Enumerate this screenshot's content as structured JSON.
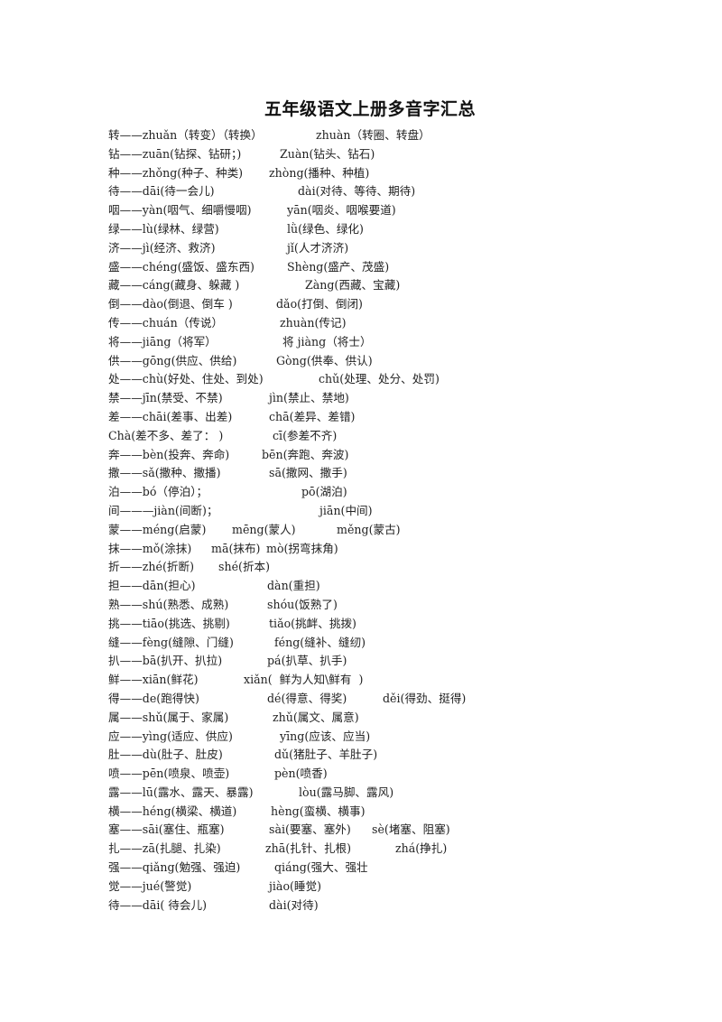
{
  "document": {
    "title": "五年级语文上册多音字汇总",
    "lines": [
      {
        "main": "转——zhuǎn（转变）（转换）",
        "alts": [
          "zhuàn（转圈、转盘）"
        ]
      },
      {
        "main": "钻——zuān(钻探、钻研；)",
        "alts": [
          "Zuàn(钻头、钻石)"
        ]
      },
      {
        "main": "种——zhǒng(种子、种类)",
        "alts": [
          "zhòng(播种、种植)"
        ]
      },
      {
        "main": "待——dāi(待一会儿)",
        "alts": [
          "dài(对待、等待、期待)"
        ]
      },
      {
        "main": "咽——yàn(咽气、细嚼慢咽)",
        "alts": [
          "yān(咽炎、咽喉要道)"
        ]
      },
      {
        "main": "绿——lù(绿林、绿营)",
        "alts": [
          "lǜ(绿色、绿化)"
        ]
      },
      {
        "main": "济——jì(经济、救济)",
        "alts": [
          "jǐ(人才济济)"
        ]
      },
      {
        "main": "盛——chéng(盛饭、盛东西)",
        "alts": [
          "Shèng(盛产、茂盛)"
        ]
      },
      {
        "main": "藏——cáng(藏身、躲藏 )",
        "alts": [
          "Zàng(西藏、宝藏)"
        ]
      },
      {
        "main": "倒——dào(倒退、倒车 )",
        "alts": [
          "dǎo(打倒、倒闭)"
        ]
      },
      {
        "main": "传——chuán（传说）",
        "alts": [
          "zhuàn(传记)"
        ]
      },
      {
        "main": "将——jiāng（将军）",
        "alts": [
          "将 jiàng（将士）"
        ]
      },
      {
        "main": "供——gōng(供应、供给)",
        "alts": [
          "Gòng(供奉、供认)"
        ]
      },
      {
        "main": "处——chù(好处、住处、到处)",
        "alts": [
          "chǔ(处理、处分、处罚)"
        ]
      },
      {
        "main": "禁——jīn(禁受、不禁)",
        "alts": [
          "jìn(禁止、禁地)"
        ]
      },
      {
        "main": "差——chāi(差事、出差)",
        "alts": [
          "chā(差异、差错)"
        ]
      },
      {
        "main": "Chà(差不多、差了： )",
        "alts": [
          "cī(参差不齐)"
        ]
      },
      {
        "main": "奔——bèn(投奔、奔命)",
        "alts": [
          "bēn(奔跑、奔波)"
        ]
      },
      {
        "main": "撒——sǎ(撒种、撒播)",
        "alts": [
          "sā(撒网、撒手)"
        ]
      },
      {
        "main": "泊——bó（停泊）；",
        "alts": [
          "pō(湖泊)"
        ]
      },
      {
        "main": "间———jiàn(间断)；",
        "alts": [
          "jiān(中间)"
        ]
      },
      {
        "main": "蒙——méng(启蒙)",
        "alts": [
          "mēng(蒙人)",
          "měng(蒙古)"
        ]
      },
      {
        "main": "抹——mǒ(涂抹)",
        "alts": [
          "mā(抹布)",
          "mò(拐弯抹角)"
        ]
      },
      {
        "main": "折——zhé(折断)",
        "alts": [
          "shé(折本)"
        ]
      },
      {
        "main": "担——dān(担心)",
        "alts": [
          "dàn(重担)"
        ]
      },
      {
        "main": "熟——shú(熟悉、成熟)",
        "alts": [
          "shóu(饭熟了)"
        ]
      },
      {
        "main": "挑——tiāo(挑选、挑剔)",
        "alts": [
          "tiǎo(挑衅、挑拨)"
        ]
      },
      {
        "main": "缝——fèng(缝隙、门缝)",
        "alts": [
          "féng(缝补、缝纫)"
        ]
      },
      {
        "main": "扒——bā(扒开、扒拉)",
        "alts": [
          "pá(扒草、扒手)"
        ]
      },
      {
        "main": "鲜——xiān(鲜花)",
        "alts": [
          "xiǎn(  鲜为人知\\鲜有  )"
        ]
      },
      {
        "main": "得——de(跑得快)",
        "alts": [
          "dé(得意、得奖)",
          "děi(得劲、挺得)"
        ]
      },
      {
        "main": "属——shǔ(属于、家属)",
        "alts": [
          "zhǔ(属文、属意)"
        ]
      },
      {
        "main": "应——yìng(适应、供应)",
        "alts": [
          "yīng(应该、应当)"
        ]
      },
      {
        "main": "肚——dù(肚子、肚皮)",
        "alts": [
          "dǔ(猪肚子、羊肚子)"
        ]
      },
      {
        "main": "喷——pēn(喷泉、喷壶)",
        "alts": [
          "pèn(喷香)"
        ]
      },
      {
        "main": "露——lū(露水、露天、暴露)",
        "alts": [
          "lòu(露马脚、露风)"
        ]
      },
      {
        "main": "横——héng(横梁、横道)",
        "alts": [
          "hèng(蛮横、横事)"
        ]
      },
      {
        "main": "塞——sāi(塞住、瓶塞)",
        "alts": [
          "sài(要塞、塞外)",
          "sè(堵塞、阻塞)"
        ]
      },
      {
        "main": "扎——zā(扎腿、扎染)",
        "alts": [
          "zhā(扎针、扎根)",
          "zhá(挣扎)"
        ]
      },
      {
        "main": "强——qiǎng(勉强、强迫)",
        "alts": [
          "qiáng(强大、强壮"
        ]
      },
      {
        "main": "觉——jué(警觉)",
        "alts": [
          "jiào(睡觉)"
        ]
      },
      {
        "main": "待——dāi( 待会儿)",
        "alts": [
          "dài(对待)"
        ]
      }
    ]
  }
}
